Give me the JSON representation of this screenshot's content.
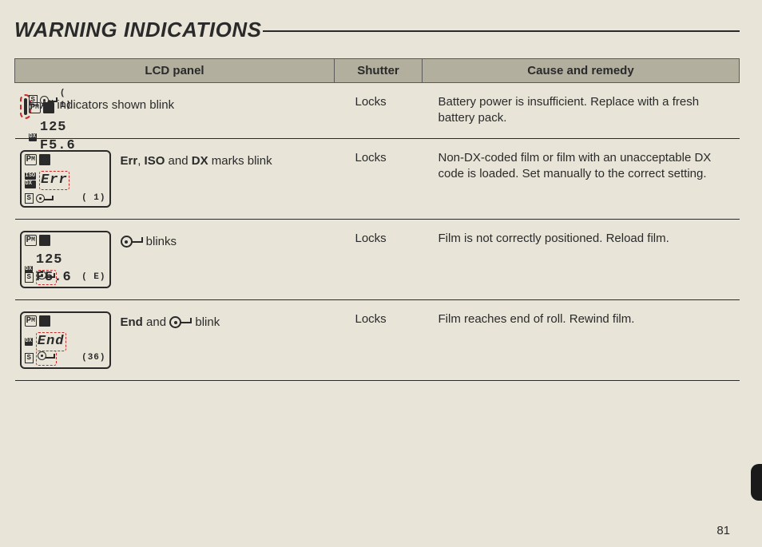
{
  "title": "WARNING INDICATIONS",
  "headers": {
    "lcd": "LCD panel",
    "shutter": "Shutter",
    "remedy": "Cause and remedy"
  },
  "rows": [
    {
      "lcd_display": {
        "line2": "125 F5.6",
        "frame": "( 1)",
        "mode": "P",
        "dx_label": "DX",
        "s_label": "S"
      },
      "desc_prefix": "",
      "desc_bold_parts": [],
      "desc": "All indicators shown blink",
      "shutter": "Locks",
      "remedy": "Battery power is insufficient. Replace with a fresh battery pack."
    },
    {
      "lcd_display": {
        "line2": "Err",
        "frame": "( 1)",
        "mode": "P",
        "iso_label": "ISO",
        "dx_label": "DX",
        "s_label": "S"
      },
      "desc_bold1": "Err",
      "desc_sep1": ", ",
      "desc_bold2": "ISO",
      "desc_sep2": " and ",
      "desc_bold3": "DX",
      "desc_tail": " marks blink",
      "shutter": "Locks",
      "remedy": "Non-DX-coded film or film with an unacceptable DX code is loaded. Set manually to the correct setting."
    },
    {
      "lcd_display": {
        "line2": "125 F5.6",
        "frame": "( E)",
        "mode": "P",
        "dx_label": "DX",
        "s_label": "S"
      },
      "desc_tail": " blinks",
      "shutter": "Locks",
      "remedy": "Film is not correctly positioned. Reload film."
    },
    {
      "lcd_display": {
        "line2": "End",
        "frame": "(36)",
        "mode": "P",
        "dx_label": "DX",
        "s_label": "S"
      },
      "desc_bold1": "End",
      "desc_sep1": " and ",
      "desc_tail": " blink",
      "shutter": "Locks",
      "remedy": "Film reaches end of roll. Rewind film."
    }
  ],
  "page_number": "81"
}
